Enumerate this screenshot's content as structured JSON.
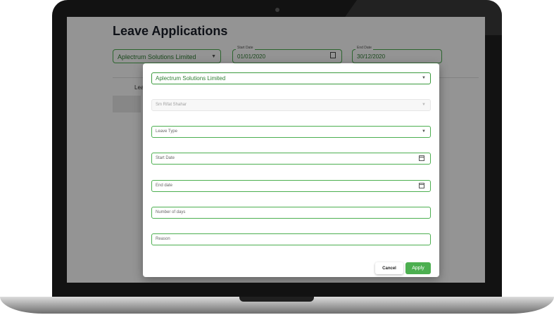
{
  "app": {
    "title": "Leave Applications"
  },
  "filters": {
    "company": "Aplectrum Solutions Limited",
    "start_date_label": "Start Date",
    "start_date": "01/01/2020",
    "end_date_label": "End Date",
    "end_date": "30/12/2020"
  },
  "tab_partial": "Lea",
  "dialog": {
    "company": "Aplectrum Solutions Limited",
    "employee": "Sm Rifat Shahar",
    "leave_type_placeholder": "Leave Type",
    "start_date_placeholder": "Start Date",
    "end_date_placeholder": "End date",
    "days_placeholder": "Number of days",
    "reason_placeholder": "Reason",
    "cancel_label": "Cancel",
    "apply_label": "Apply"
  },
  "icons": {
    "dropdown": "chevron-down-icon",
    "calendar": "calendar-icon"
  },
  "colors": {
    "accent": "#4caf50",
    "title": "#1b1f2a"
  }
}
